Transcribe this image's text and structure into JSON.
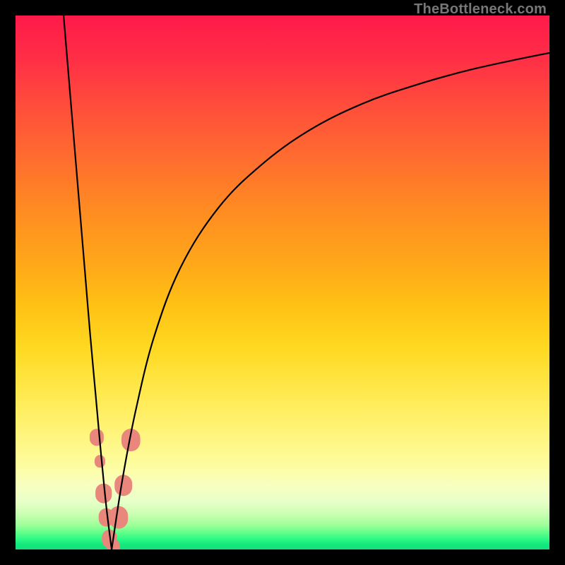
{
  "watermark": "TheBottleneck.com",
  "chart_data": {
    "type": "line",
    "title": "",
    "xlabel": "",
    "ylabel": "",
    "xlim": [
      0,
      100
    ],
    "ylim": [
      0,
      100
    ],
    "grid": false,
    "legend": false,
    "background_gradient": {
      "orientation": "vertical",
      "stops": [
        {
          "pos": 0.0,
          "color": "#ff1a4a"
        },
        {
          "pos": 0.5,
          "color": "#ffb81a"
        },
        {
          "pos": 0.8,
          "color": "#fff47a"
        },
        {
          "pos": 0.93,
          "color": "#c8ffb0"
        },
        {
          "pos": 1.0,
          "color": "#14e07a"
        }
      ]
    },
    "series": [
      {
        "name": "bottleneck-curve-left",
        "color": "#000000",
        "x": [
          9.0,
          10.0,
          11.0,
          12.0,
          13.0,
          14.0,
          15.0,
          16.0,
          17.0,
          18.0
        ],
        "y": [
          100.0,
          88.0,
          76.0,
          64.0,
          52.0,
          40.0,
          29.0,
          18.0,
          8.0,
          0.0
        ]
      },
      {
        "name": "bottleneck-curve-right",
        "color": "#000000",
        "x": [
          18.0,
          20.0,
          22.5,
          26.0,
          31.0,
          38.0,
          46.0,
          55.0,
          65.0,
          75.0,
          85.0,
          95.0,
          100.0
        ],
        "y": [
          0.0,
          13.0,
          26.0,
          40.0,
          53.0,
          64.0,
          72.0,
          78.5,
          83.5,
          87.0,
          89.8,
          92.0,
          93.0
        ]
      }
    ],
    "markers": {
      "name": "highlight-points",
      "color": "#e9877c",
      "shape": "rounded",
      "points": [
        {
          "x": 15.2,
          "y": 21.0,
          "r": 1.2
        },
        {
          "x": 15.8,
          "y": 16.5,
          "r": 0.9
        },
        {
          "x": 16.5,
          "y": 10.5,
          "r": 1.4
        },
        {
          "x": 17.0,
          "y": 6.0,
          "r": 1.3
        },
        {
          "x": 17.6,
          "y": 2.0,
          "r": 1.3
        },
        {
          "x": 18.3,
          "y": 0.5,
          "r": 1.1
        },
        {
          "x": 19.3,
          "y": 6.0,
          "r": 1.6
        },
        {
          "x": 20.2,
          "y": 12.0,
          "r": 1.5
        },
        {
          "x": 21.6,
          "y": 20.5,
          "r": 1.6
        }
      ]
    }
  }
}
